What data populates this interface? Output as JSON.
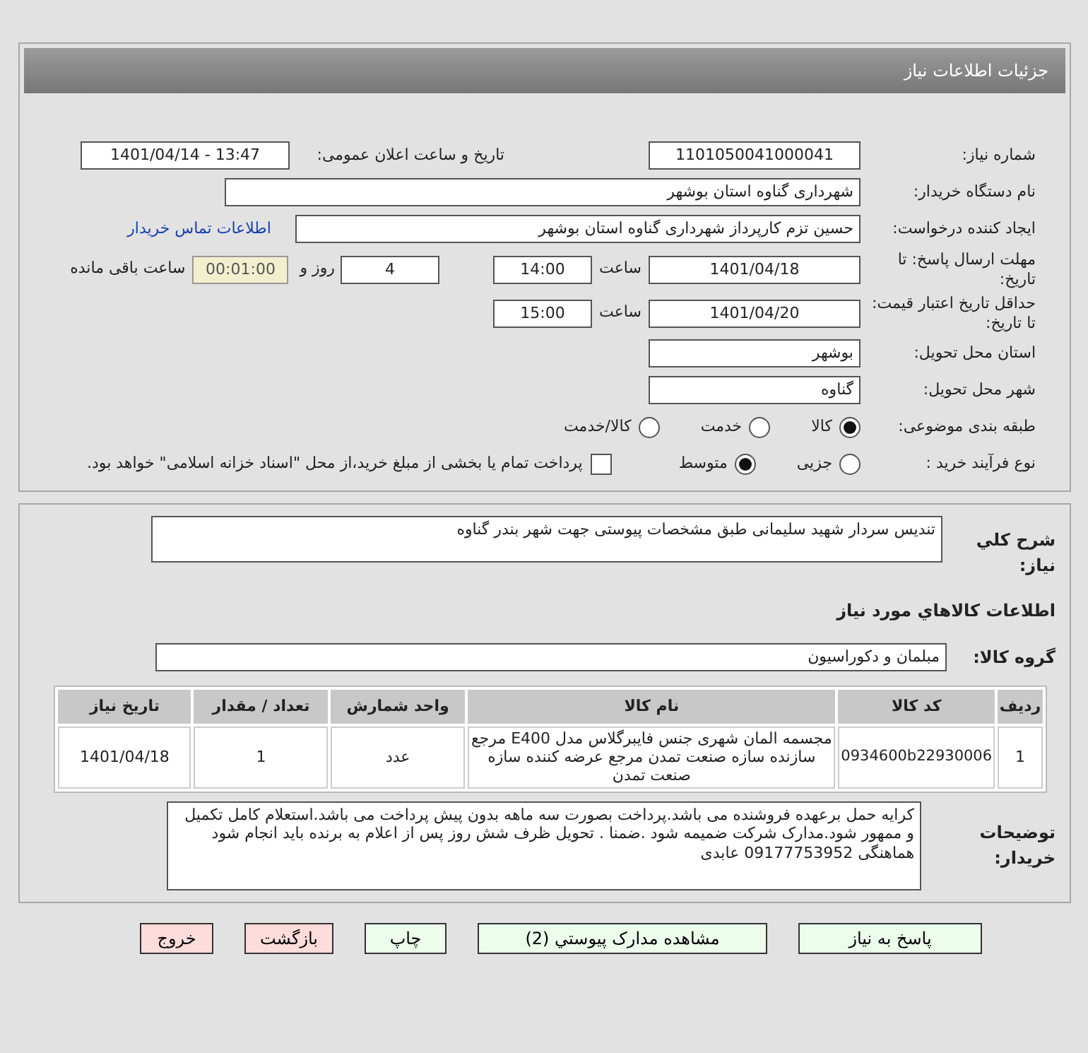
{
  "header": {
    "title": "جزئیات اطلاعات نیاز"
  },
  "need": {
    "label": "شماره نیاز:",
    "value": "1101050041000041",
    "announce_label": "تاریخ و ساعت اعلان عمومی:",
    "announce_value": "1401/04/14 - 13:47"
  },
  "buyer": {
    "label": "نام دستگاه خریدار:",
    "value": "شهرداری گناوه استان بوشهر"
  },
  "requester": {
    "label": "ایجاد کننده درخواست:",
    "value": "حسین تزم کارپرداز شهرداری گناوه استان بوشهر",
    "contact_link": "اطلاعات تماس خریدار"
  },
  "deadline": {
    "label": "مهلت ارسال پاسخ: تا تاریخ:",
    "date": "1401/04/18",
    "time_label": "ساعت",
    "time": "14:00",
    "days": "4",
    "days_label": "روز و",
    "remaining": "00:01:00",
    "remaining_label": "ساعت باقی مانده"
  },
  "validity": {
    "label": "حداقل تاریخ اعتبار قیمت: تا تاریخ:",
    "date": "1401/04/20",
    "time_label": "ساعت",
    "time": "15:00"
  },
  "province": {
    "label": "استان محل تحویل:",
    "value": "بوشهر"
  },
  "city": {
    "label": "شهر محل تحویل:",
    "value": "گناوه"
  },
  "category": {
    "label": "طبقه بندی موضوعی:",
    "options": [
      {
        "label": "کالا",
        "selected": true
      },
      {
        "label": "خدمت",
        "selected": false
      },
      {
        "label": "کالا/خدمت",
        "selected": false
      }
    ]
  },
  "process": {
    "label": "نوع فرآیند خرید :",
    "options": [
      {
        "label": "جزیی",
        "selected": false
      },
      {
        "label": "متوسط",
        "selected": true
      }
    ],
    "payment": {
      "checked": false,
      "text": "پرداخت تمام یا بخشی از مبلغ خرید،از محل \"اسناد خزانه اسلامی\" خواهد بود."
    }
  },
  "summary": {
    "label": "شرح کلي نیاز:",
    "value": "تندیس سردار شهید سلیمانی طبق مشخصات پیوستی جهت شهر بندر گناوه"
  },
  "goods_title": "اطلاعات کالاهاي مورد نیاز",
  "group": {
    "label": "گروه کالا:",
    "value": "مبلمان و دکوراسیون"
  },
  "table": {
    "columns": [
      "ردیف",
      "کد کالا",
      "نام کالا",
      "واحد شمارش",
      "تعداد / مقدار",
      "تاریخ نیاز"
    ],
    "rows": [
      [
        "1",
        "0934600b22930006",
        "مجسمه المان شهری جنس فایبرگلاس مدل E400 مرجع سازنده سازه صنعت تمدن مرجع عرضه کننده سازه صنعت تمدن",
        "عدد",
        "1",
        "1401/04/18"
      ]
    ]
  },
  "notes": {
    "label": "توضیحات خریدار:",
    "value": "کرایه حمل برعهده فروشنده می باشد.پرداخت بصورت سه ماهه بدون پیش پرداخت می باشد.استعلام کامل تکمیل و ممهور شود.مدارک شرکت ضمیمه شود .ضمنا . تحویل ظرف شش روز پس از اعلام به برنده باید انجام شود هماهنگی 09177753952 عابدی"
  },
  "buttons": [
    {
      "label": "پاسخ به نیاز",
      "kind": "primary"
    },
    {
      "label": "مشاهده مدارک پیوستي (2)",
      "kind": "primary"
    },
    {
      "label": "چاپ",
      "kind": "primary"
    },
    {
      "label": "بازگشت",
      "kind": "danger"
    },
    {
      "label": "خروج",
      "kind": "danger"
    }
  ]
}
